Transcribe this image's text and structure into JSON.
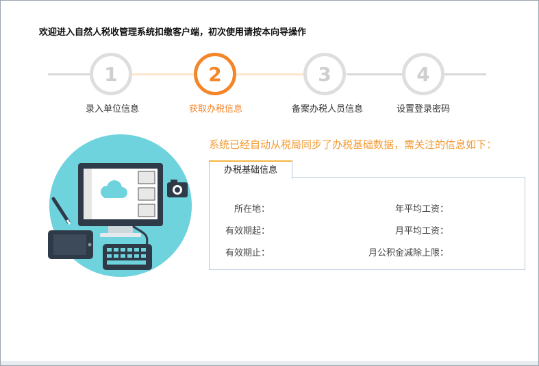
{
  "header": {
    "title": "欢迎进入自然人税收管理系统扣缴客户端，初次使用请按本向导操作"
  },
  "steps": [
    {
      "number": "1",
      "label": "录入单位信息",
      "state": "done"
    },
    {
      "number": "2",
      "label": "获取办税信息",
      "state": "active"
    },
    {
      "number": "3",
      "label": "备案办税人员信息",
      "state": "pending"
    },
    {
      "number": "4",
      "label": "设置登录密码",
      "state": "pending"
    }
  ],
  "notice": {
    "text": "系统已经自动从税局同步了办税基础数据，需关注的信息如下："
  },
  "info_panel": {
    "tab_label": "办税基础信息",
    "fields": {
      "location": {
        "label": "所在地：",
        "value": ""
      },
      "valid_from": {
        "label": "有效期起：",
        "value": ""
      },
      "valid_to": {
        "label": "有效期止：",
        "value": ""
      },
      "annual_avg_wage": {
        "label": "年平均工资：",
        "value": ""
      },
      "monthly_avg_wage": {
        "label": "月平均工资：",
        "value": ""
      },
      "housing_fund_cap": {
        "label": "月公积金减除上限：",
        "value": ""
      }
    }
  },
  "colors": {
    "accent": "#f4862a",
    "notice": "#f39a32",
    "inactive_circle": "#dedede",
    "illustration_bg": "#6ed3dd"
  },
  "illustration": {
    "icons": [
      "monitor-icon",
      "cloud-icon",
      "camera-icon",
      "keyboard-icon",
      "tablet-icon",
      "pen-icon"
    ]
  }
}
